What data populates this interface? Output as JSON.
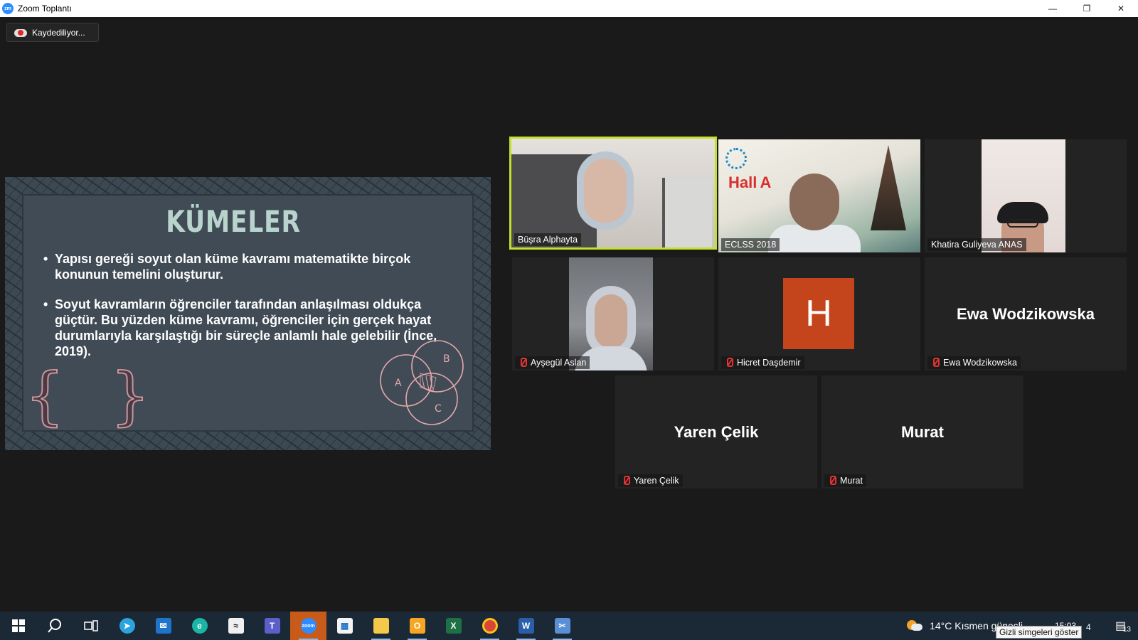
{
  "window": {
    "title": "Zoom Toplantı",
    "logo_text": "zm",
    "controls": [
      "—",
      "❐",
      "✕"
    ]
  },
  "recording": {
    "label": "Kaydediliyor..."
  },
  "slide": {
    "title": "KÜMELER",
    "bullets": [
      "Yapısı gereği soyut olan küme kavramı matematikte birçok konunun temelini oluşturur.",
      "Soyut kavramların öğrenciler tarafından anlaşılması oldukça güçtür. Bu yüzden küme kavramı, öğrenciler için gerçek hayat durumlarıyla karşılaştığı bir süreçle anlamlı hale gelebilir (İnce, 2019)."
    ],
    "braces": "{ }",
    "venn_labels": [
      "A",
      "B",
      "C"
    ]
  },
  "eclss_banner": {
    "hall": "Hall",
    "hall_letter": "A"
  },
  "participants": [
    {
      "name": "Büşra Alphayta",
      "video": true,
      "active": true,
      "muted": false
    },
    {
      "name": "ECLSS 2018",
      "video": true,
      "active": false,
      "muted": false
    },
    {
      "name": "Khatira Guliyeva ANAS",
      "video": true,
      "active": false,
      "muted": false
    },
    {
      "name": "Ayşegül Aslan",
      "video": true,
      "active": false,
      "muted": true
    },
    {
      "name": "Hicret Daşdemir",
      "video": false,
      "avatar_letter": "H",
      "muted": true
    },
    {
      "name": "Ewa Wodzikowska",
      "video": false,
      "display": "Ewa Wodzikowska",
      "muted": true
    },
    {
      "name": "Yaren Çelik",
      "video": false,
      "display": "Yaren Çelik",
      "muted": true
    },
    {
      "name": "Murat",
      "video": false,
      "display": "Murat",
      "muted": true
    }
  ],
  "taskbar": {
    "weather": "14°C  Kısmen güneşli",
    "time": "15:03",
    "tooltip": "Gizli simgeleri göster",
    "tray_number": "4",
    "notification_count": "13",
    "zoom_label": "zoom",
    "zoom_color": "#2d8cff",
    "accent_active_speaker": "#c3e02c",
    "avatar_color": "#c4441c"
  }
}
